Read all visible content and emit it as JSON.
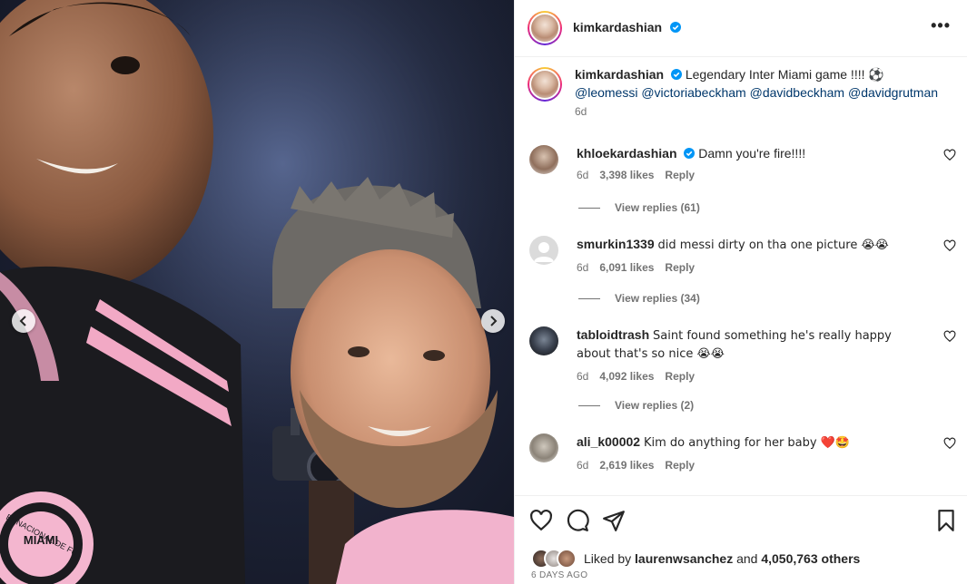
{
  "post": {
    "author": "kimkardashian",
    "caption_text": "Legendary Inter Miami game !!!! ⚽",
    "mentions": [
      "@leomessi",
      "@victoriabeckham",
      "@davidbeckham",
      "@davidgrutman"
    ],
    "caption_time": "6d",
    "badge_text": "MIAMI",
    "badge_ring_text": "ERNACIONAL DE FÚ"
  },
  "comments": [
    {
      "user": "khloekardashian",
      "verified": true,
      "text": "Damn you're fire!!!!",
      "time": "6d",
      "likes": "3,398 likes",
      "reply": "Reply",
      "view_replies": "View replies (61)"
    },
    {
      "user": "smurkin1339",
      "verified": false,
      "text": "did messi dirty on tha one picture 😭😭",
      "time": "6d",
      "likes": "6,091 likes",
      "reply": "Reply",
      "view_replies": "View replies (34)"
    },
    {
      "user": "tabloidtrash",
      "verified": false,
      "text": "Saint found something he's really happy about that's so nice 😭😭",
      "time": "6d",
      "likes": "4,092 likes",
      "reply": "Reply",
      "view_replies": "View replies (2)"
    },
    {
      "user": "ali_k00002",
      "verified": false,
      "text": "Kim do anything for her baby ❤️🤩",
      "time": "6d",
      "likes": "2,619 likes",
      "reply": "Reply"
    }
  ],
  "likes_summary": {
    "prefix": "Liked by",
    "user": "laurenwsanchez",
    "middle": "and",
    "count": "4,050,763 others"
  },
  "date_label": "6 DAYS AGO",
  "icons": {
    "more": "more-options-icon",
    "verified": "verified-badge-icon",
    "like": "heart-icon",
    "comment": "comment-bubble-icon",
    "share": "paper-plane-icon",
    "save": "bookmark-icon",
    "prev": "chevron-left-icon",
    "next": "chevron-right-icon"
  },
  "colors": {
    "verified": "#0095f6",
    "mention": "#00376b",
    "muted": "#737373",
    "inter_miami_pink": "#f4b6cf",
    "heart_red": "#ed1c24"
  }
}
